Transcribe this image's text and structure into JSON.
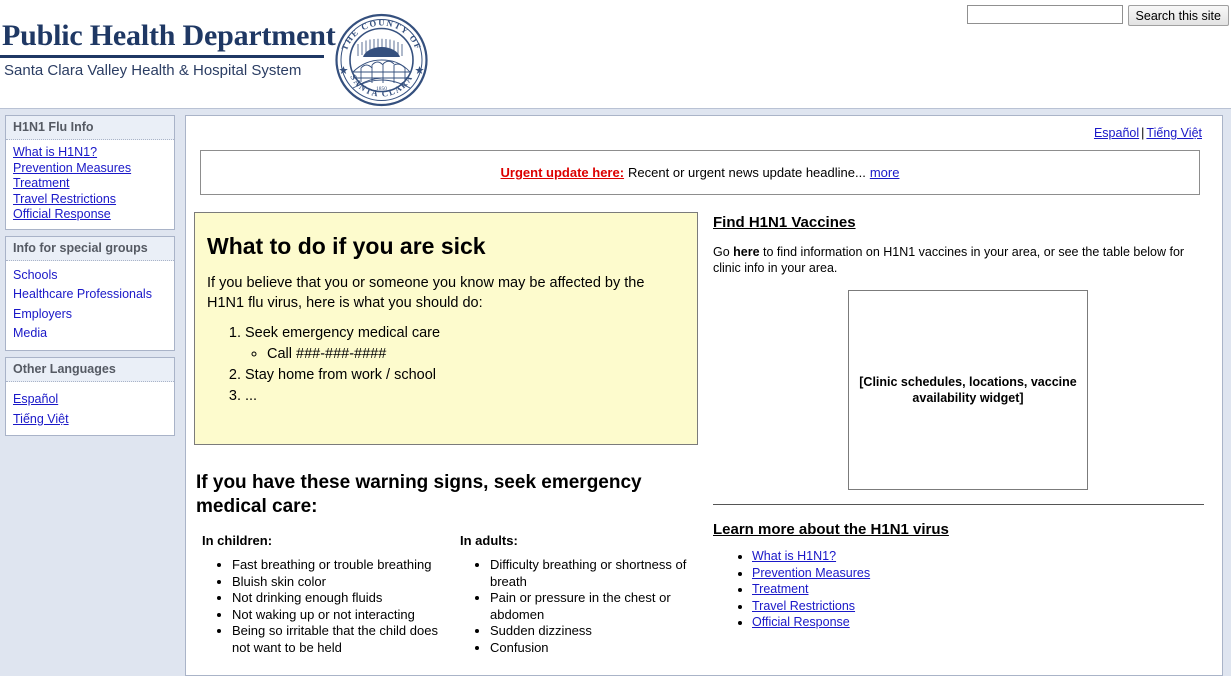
{
  "header": {
    "brand_title": "Public Health Department",
    "brand_subtitle": "Santa Clara Valley Health & Hospital System",
    "seal": {
      "top_arc": "THE COUNTY OF",
      "bottom_arc": "SANTA CLARA",
      "year": "1850"
    },
    "search": {
      "value": "",
      "placeholder": "",
      "button_label": "Search this site"
    }
  },
  "sidebar": {
    "panels": [
      {
        "heading": "H1N1 Flu Info",
        "underlined": true,
        "links": [
          "What is H1N1?",
          "Prevention Measures",
          "Treatment",
          "Travel Restrictions",
          "Official Response"
        ]
      },
      {
        "heading": "Info for special groups",
        "underlined": false,
        "links": [
          "Schools",
          "Healthcare Professionals",
          "Employers",
          "Media"
        ]
      },
      {
        "heading": "Other Languages",
        "underlined": true,
        "links": [
          "Español",
          "Tiếng Việt"
        ]
      }
    ]
  },
  "content": {
    "language_bar": {
      "spanish": "Español",
      "separator": "|",
      "vietnamese": "Tiếng Việt"
    },
    "urgent_banner": {
      "label": "Urgent update here:",
      "text": "Recent or urgent news update headline...",
      "more_link": "more"
    },
    "sick_box": {
      "title": "What to do if you are sick",
      "intro": "If you believe that you or someone you know may be affected by the H1N1 flu virus, here is what you should do:",
      "step_1": "Seek emergency medical care",
      "step_1_sub": "Call ###-###-####",
      "step_2": "Stay home from work / school",
      "step_3": "..."
    },
    "warning": {
      "title": "If you have these warning signs, seek emergency medical care:",
      "children_heading": "In children:",
      "children_items": [
        "Fast breathing or trouble breathing",
        "Bluish skin color",
        "Not drinking enough fluids",
        "Not waking up or not interacting",
        "Being so irritable that the child does not want to be held"
      ],
      "adults_heading": "In adults:",
      "adults_items": [
        "Difficulty breathing or shortness of breath",
        "Pain or pressure in the chest or abdomen",
        "Sudden dizziness",
        "Confusion"
      ]
    },
    "vaccines": {
      "title": "Find H1N1 Vaccines",
      "text_before": "Go ",
      "text_bold": "here",
      "text_after": " to find information on H1N1 vaccines in your area, or see the table below for clinic info in your area.",
      "widget_placeholder": "[Clinic schedules, locations, vaccine availability widget]"
    },
    "learn_more": {
      "title": "Learn more about the H1N1 virus",
      "links": [
        "What is H1N1?",
        "Prevention Measures",
        "Treatment",
        "Travel Restrictions",
        "Official Response"
      ]
    }
  },
  "colors": {
    "brand_navy": "#1f3864",
    "link_blue": "#1a18c8",
    "urgent_red": "#dc0000",
    "callout_yellow": "#fdfbcd",
    "page_blue_gray": "#dfe5f0"
  }
}
